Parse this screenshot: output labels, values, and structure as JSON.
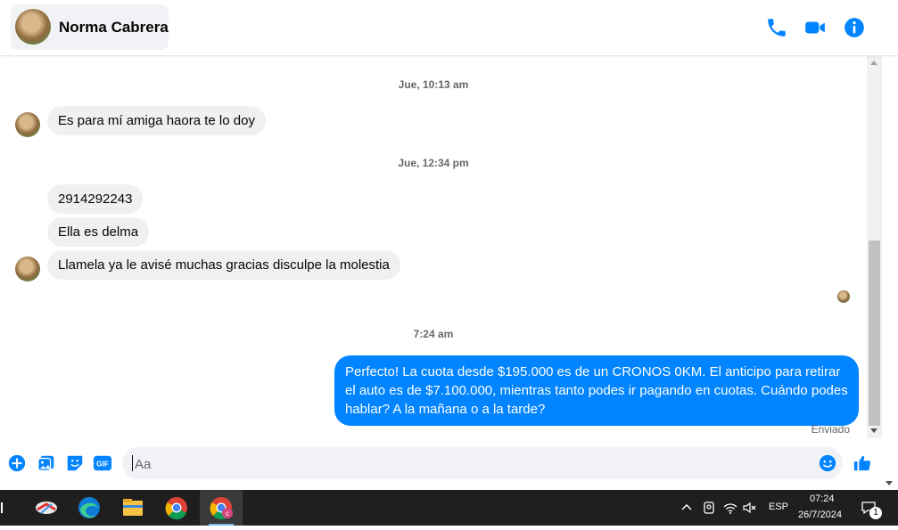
{
  "header": {
    "contact_name": "Norma Cabrera",
    "actions": [
      {
        "icon": "phone-icon"
      },
      {
        "icon": "video-call-icon"
      },
      {
        "icon": "info-icon"
      }
    ]
  },
  "messages": {
    "timestamps": [
      "Jue, 10:13 am",
      "Jue, 12:34 pm",
      "7:24 am"
    ],
    "incoming": [
      "Es para mí amiga haora te lo doy",
      "2914292243",
      "Ella es delma",
      "Llamela ya le avisé muchas gracias disculpe la molestia"
    ],
    "outgoing": "Perfecto! La cuota desde $195.000 es de un CRONOS 0KM. El anticipo para retirar el auto es de $7.100.000, mientras tanto podes ir pagando en cuotas. Cuándo podes hablar? A la mañana o a la tarde?",
    "status": "Enviado"
  },
  "composer": {
    "placeholder": "Aa",
    "icons": [
      "plus-icon",
      "photo-icon",
      "sticker-icon",
      "gif-icon",
      "emoji-icon",
      "like-icon"
    ],
    "gif_label": "GIF"
  },
  "taskbar": {
    "language": "ESP",
    "time": "07:24",
    "date": "26/7/2024",
    "notification_count": "1"
  },
  "colors": {
    "accent": "#0084ff",
    "bubble_in": "#f0f0f0",
    "taskbar": "#1f1f1f"
  }
}
